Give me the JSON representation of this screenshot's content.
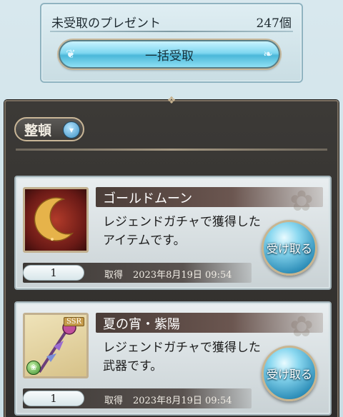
{
  "summary": {
    "title": "未受取のプレゼント",
    "count": "247個",
    "receive_all_label": "一括受取"
  },
  "sort": {
    "label": "整頓"
  },
  "gifts": [
    {
      "name": "ゴールドムーン",
      "description": "レジェンドガチャで獲得したアイテムです。",
      "quantity": "1",
      "date_label": "取得",
      "date": "2023年8月19日 09:54",
      "receive_label": "受け取る"
    },
    {
      "name": "夏の宵・紫陽",
      "description": "レジェンドガチャで獲得した武器です。",
      "quantity": "1",
      "date_label": "取得",
      "date": "2023年8月19日 09:54",
      "receive_label": "受け取る",
      "rarity": "SSR"
    }
  ],
  "colors": {
    "accent_button": "#4bb8d9",
    "panel_dark": "#2e2c2a",
    "frame_gold": "#c9b697"
  },
  "icons": [
    "flourish-left-icon",
    "flourish-right-icon",
    "ornament-icon",
    "chevron-down-icon",
    "wind-element-icon"
  ]
}
